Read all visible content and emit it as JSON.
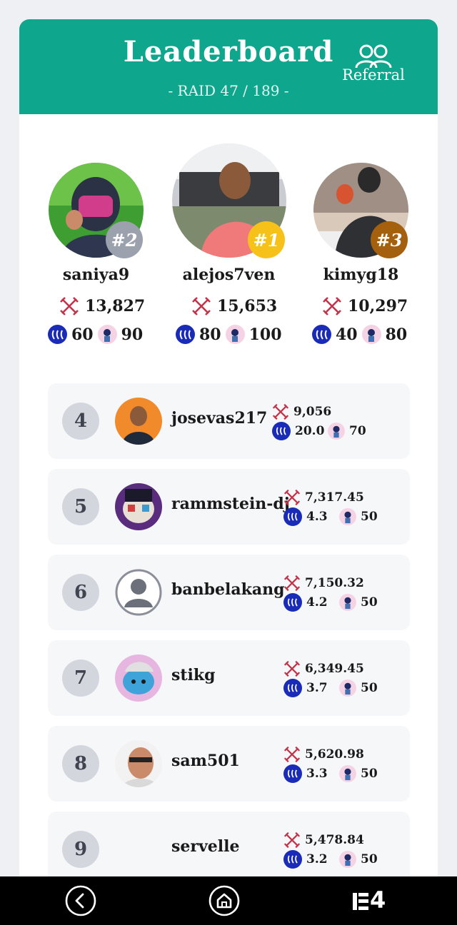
{
  "header": {
    "title": "Leaderboard",
    "subtitle": "- RAID 47 / 189 -",
    "referral_label": "Referral",
    "color": "#0fa68e"
  },
  "podium": [
    {
      "rank_label": "#2",
      "username": "saniya9",
      "score": "13,827",
      "steem": "60",
      "tokens": "90",
      "badge_color": "#9ba1ad"
    },
    {
      "rank_label": "#1",
      "username": "alejos7ven",
      "score": "15,653",
      "steem": "80",
      "tokens": "100",
      "badge_color": "#f6c21a"
    },
    {
      "rank_label": "#3",
      "username": "kimyg18",
      "score": "10,297",
      "steem": "40",
      "tokens": "80",
      "badge_color": "#a5600d"
    }
  ],
  "rows": [
    {
      "rank": "4",
      "username": "josevas217",
      "score": "9,056",
      "steem": "20.0",
      "tokens": "70"
    },
    {
      "rank": "5",
      "username": "rammstein-dj",
      "score": "7,317.45",
      "steem": "4.3",
      "tokens": "50"
    },
    {
      "rank": "6",
      "username": "banbelakang",
      "score": "7,150.32",
      "steem": "4.2",
      "tokens": "50"
    },
    {
      "rank": "7",
      "username": "stikg",
      "score": "6,349.45",
      "steem": "3.7",
      "tokens": "50"
    },
    {
      "rank": "8",
      "username": "sam501",
      "score": "5,620.98",
      "steem": "3.3",
      "tokens": "50"
    },
    {
      "rank": "9",
      "username": "servelle",
      "score": "5,478.84",
      "steem": "3.2",
      "tokens": "50"
    }
  ],
  "nav": {
    "icons": [
      "back-icon",
      "home-icon",
      "app-logo-icon"
    ],
    "app_logo_text": "4"
  }
}
